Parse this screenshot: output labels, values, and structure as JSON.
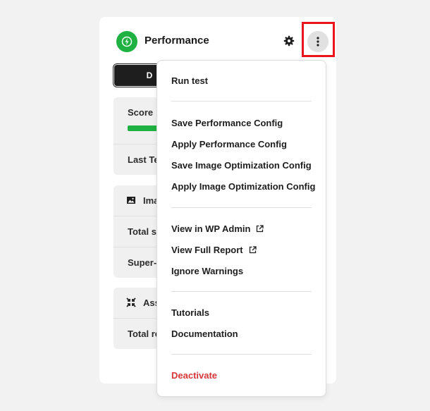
{
  "header": {
    "title": "Performance",
    "logo_icon": "lightning-bolt-icon",
    "settings_icon": "gear-icon",
    "more_icon": "vertical-dots-icon",
    "accent_color": "#1fb141",
    "highlight_color": "#e8141f"
  },
  "tab": {
    "label": "D"
  },
  "summary": {
    "score_label": "Score",
    "score_color": "#1fb141",
    "last_test_label": "Last Te"
  },
  "images_section": {
    "label": "Ima",
    "icon": "image-icon",
    "rows": [
      "Total s",
      "Super-"
    ]
  },
  "assets_section": {
    "label": "Ass",
    "icon": "compress-icon",
    "rows": [
      "Total re"
    ]
  },
  "menu": {
    "groups": [
      {
        "items": [
          {
            "label": "Run test"
          }
        ]
      },
      {
        "items": [
          {
            "label": "Save Performance Config"
          },
          {
            "label": "Apply Performance Config"
          },
          {
            "label": "Save Image Optimization Config"
          },
          {
            "label": "Apply Image Optimization Config"
          }
        ]
      },
      {
        "items": [
          {
            "label": "View in WP Admin",
            "icon": "external-link-icon"
          },
          {
            "label": "View Full Report",
            "icon": "external-link-icon"
          },
          {
            "label": "Ignore Warnings"
          }
        ]
      },
      {
        "items": [
          {
            "label": "Tutorials"
          },
          {
            "label": "Documentation"
          }
        ]
      },
      {
        "items": [
          {
            "label": "Deactivate",
            "color": "#d63638"
          }
        ]
      }
    ]
  }
}
